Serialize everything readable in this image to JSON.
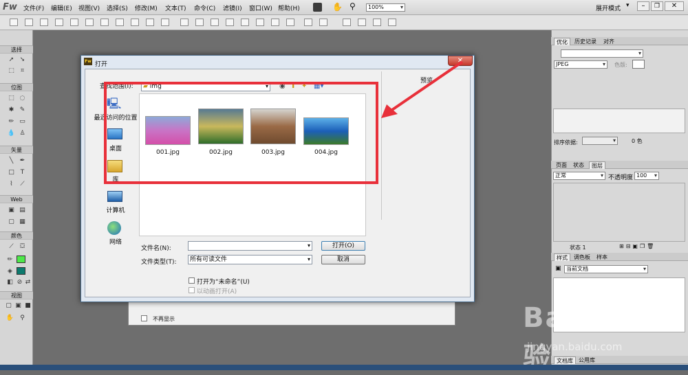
{
  "app": {
    "logo": "Fw",
    "layout_mode": "展开模式",
    "zoom": "100%"
  },
  "menu": [
    "文件(F)",
    "编辑(E)",
    "视图(V)",
    "选择(S)",
    "修改(M)",
    "文本(T)",
    "命令(C)",
    "滤镜(I)",
    "窗口(W)",
    "帮助(H)"
  ],
  "left_panel": {
    "sections": [
      "选择",
      "位图",
      "矢量",
      "Web",
      "颜色",
      "视图"
    ]
  },
  "right_panel": {
    "optimize_tabs": [
      "优化",
      "历史记录",
      "对齐"
    ],
    "format": "JPEG",
    "matte_label": "色版:",
    "sort_label": "排序依据:",
    "colors_count": "0 色",
    "layers_tabs": [
      "页面",
      "状态",
      "图层"
    ],
    "blend_mode": "正常",
    "opacity_label": "不透明度",
    "opacity_value": "100",
    "state_label": "状态 1",
    "styles_tabs": [
      "样式",
      "调色板",
      "样本"
    ],
    "current_doc": "当前文档",
    "bottom_tabs": [
      "文档库",
      "公用库"
    ]
  },
  "bg_dialog": {
    "dont_show": "不再显示"
  },
  "dialog": {
    "title": "打开",
    "lookin_label": "查找范围(I):",
    "folder": "img",
    "preview_label": "预览",
    "places": [
      "最近访问的位置",
      "桌面",
      "库",
      "计算机",
      "网络"
    ],
    "files": [
      {
        "name": "001.jpg",
        "colors": [
          "#8ea9d8",
          "#c874c6",
          "#d44fa9"
        ]
      },
      {
        "name": "002.jpg",
        "colors": [
          "#577a92",
          "#c9b85c",
          "#2f6d2a"
        ]
      },
      {
        "name": "003.jpg",
        "colors": [
          "#d5d4cf",
          "#9a6a46",
          "#6f4b2f"
        ]
      },
      {
        "name": "004.jpg",
        "colors": [
          "#5cb0e8",
          "#1c5fb8",
          "#3c7a2a"
        ]
      }
    ],
    "filename_label": "文件名(N):",
    "filename_value": "",
    "filetype_label": "文件类型(T):",
    "filetype_value": "所有可读文件",
    "open_button": "打开(O)",
    "cancel_button": "取消",
    "open_as_untitled": "打开为“未命名”(U)",
    "open_as_animation": "以动画打开(A)"
  },
  "watermark": {
    "text": "Bai du 经验",
    "url": "jingyan.baidu.com"
  }
}
